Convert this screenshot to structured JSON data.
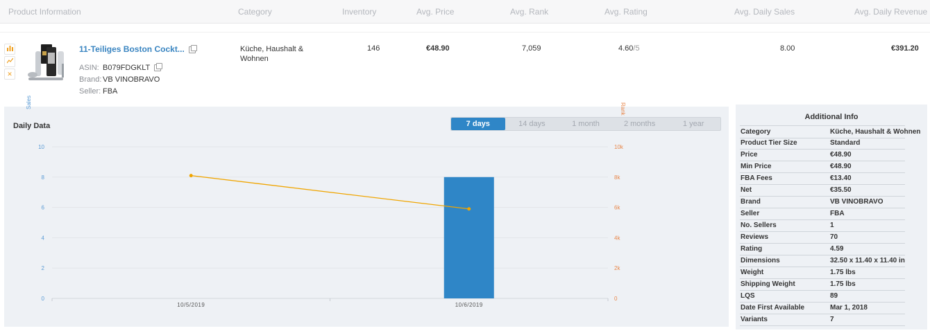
{
  "header": {
    "product_information": "Product Information",
    "category": "Category",
    "inventory": "Inventory",
    "avg_price": "Avg. Price",
    "avg_rank": "Avg. Rank",
    "avg_rating": "Avg. Rating",
    "avg_daily_sales": "Avg. Daily Sales",
    "avg_daily_revenue": "Avg. Daily Revenue"
  },
  "product": {
    "title": "11-Teiliges Boston Cockt...",
    "asin_label": "ASIN:",
    "asin": "B079FDGKLT",
    "brand_label": "Brand:",
    "brand": "VB VINOBRAVO",
    "seller_label": "Seller:",
    "seller": "FBA",
    "category_line1": "Küche, Haushalt &",
    "category_line2": "Wohnen",
    "inventory": "146",
    "avg_price": "€48.90",
    "avg_rank": "7,059",
    "avg_rating": "4.60",
    "avg_rating_suffix": "/5",
    "avg_daily_sales": "8.00",
    "avg_daily_revenue": "€391.20",
    "side_icons": [
      "bar-chart-icon",
      "line-chart-icon",
      "close-icon"
    ]
  },
  "daily": {
    "title": "Daily Data",
    "ranges": [
      "7 days",
      "14 days",
      "1 month",
      "2 months",
      "1 year"
    ],
    "active_range": "7 days"
  },
  "chart_data": {
    "type": "bar",
    "categories": [
      "10/5/2019",
      "10/6/2019"
    ],
    "series": [
      {
        "type": "bar",
        "axis": "left",
        "values": [
          null,
          8
        ]
      },
      {
        "type": "line",
        "axis": "right",
        "values": [
          8100,
          5900
        ]
      }
    ],
    "ylabel": "Sales",
    "ylabel_right": "Rank",
    "ylim": [
      0,
      10
    ],
    "ylim_right": [
      0,
      10000
    ],
    "yticks_left": [
      "0",
      "2",
      "4",
      "6",
      "8",
      "10"
    ],
    "yticks_right": [
      "0",
      "2k",
      "4k",
      "6k",
      "8k",
      "10k"
    ],
    "colors": {
      "bar": "#2f86c7",
      "line": "#f0a500"
    },
    "grid": true
  },
  "info": {
    "title": "Additional Info",
    "rows": [
      {
        "k": "Category",
        "v": "Küche, Haushalt & Wohnen"
      },
      {
        "k": "Product Tier Size",
        "v": "Standard"
      },
      {
        "k": "Price",
        "v": "€48.90"
      },
      {
        "k": "Min Price",
        "v": "€48.90"
      },
      {
        "k": "FBA Fees",
        "v": "€13.40"
      },
      {
        "k": "Net",
        "v": "€35.50"
      },
      {
        "k": "Brand",
        "v": "VB VINOBRAVO"
      },
      {
        "k": "Seller",
        "v": "FBA"
      },
      {
        "k": "No. Sellers",
        "v": "1"
      },
      {
        "k": "Reviews",
        "v": "70"
      },
      {
        "k": "Rating",
        "v": "4.59"
      },
      {
        "k": "Dimensions",
        "v": "32.50 x 11.40 x 11.40 in"
      },
      {
        "k": "Weight",
        "v": "1.75 lbs"
      },
      {
        "k": "Shipping Weight",
        "v": "1.75 lbs"
      },
      {
        "k": "LQS",
        "v": "89"
      },
      {
        "k": "Date First Available",
        "v": "Mar 1, 2018"
      },
      {
        "k": "Variants",
        "v": "7"
      }
    ]
  }
}
